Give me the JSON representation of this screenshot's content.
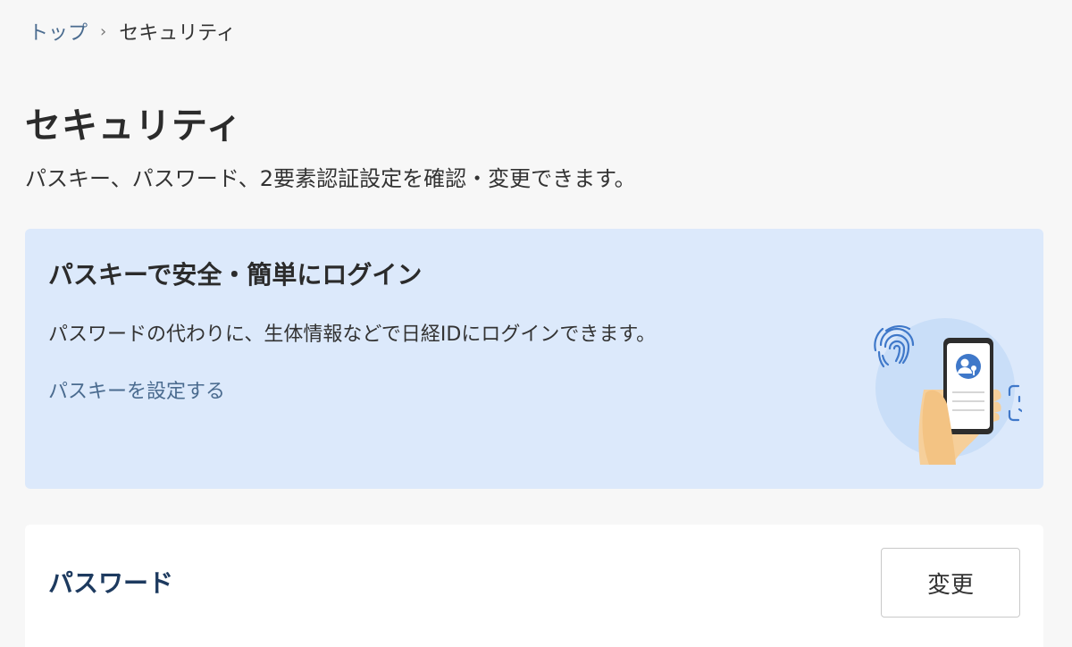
{
  "breadcrumb": {
    "home": "トップ",
    "separator": "›",
    "current": "セキュリティ"
  },
  "page": {
    "title": "セキュリティ",
    "description": "パスキー、パスワード、2要素認証設定を確認・変更できます。"
  },
  "passkey_card": {
    "title": "パスキーで安全・簡単にログイン",
    "description": "パスワードの代わりに、生体情報などで日経IDにログインできます。",
    "link_label": "パスキーを設定する",
    "illustration": "passkey-phone-fingerprint-faceid-icon"
  },
  "password_card": {
    "title": "パスワード",
    "change_label": "変更"
  },
  "colors": {
    "background": "#f7f7f7",
    "passkey_card_bg": "#dce9fb",
    "link": "#4a6b8f",
    "password_title": "#1d3a5f",
    "icon_blue": "#3f78c9"
  }
}
